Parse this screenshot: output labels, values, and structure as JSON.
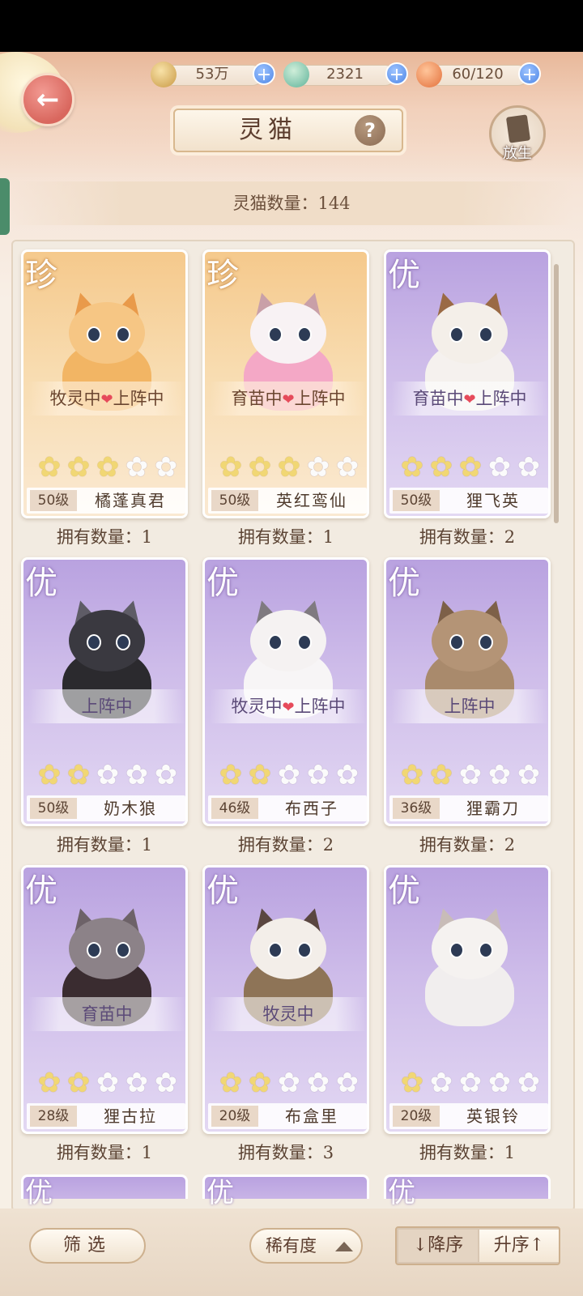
{
  "resources": [
    {
      "name": "paw-coin",
      "value": "53万"
    },
    {
      "name": "jade-gem",
      "value": "2321"
    },
    {
      "name": "food-bowl",
      "value": "60/120"
    }
  ],
  "header": {
    "title": "灵猫",
    "help": "?",
    "release_label": "放生"
  },
  "count_text": "灵猫数量：144",
  "cats": [
    {
      "rarity": "珍",
      "style": "gold",
      "status_left": "牧灵中",
      "status_right": "上阵中",
      "stars": 3,
      "level": "50级",
      "name": "橘蓬真君",
      "owned": "拥有数量：1",
      "fur": "#f2b564",
      "head": "#f6c684",
      "ear": "#e99a4a"
    },
    {
      "rarity": "珍",
      "style": "gold",
      "status_left": "育苗中",
      "status_right": "上阵中",
      "stars": 3,
      "level": "50级",
      "name": "英红鸾仙",
      "owned": "拥有数量：1",
      "fur": "#f4a8c6",
      "head": "#f8f2f4",
      "ear": "#c9a0a8"
    },
    {
      "rarity": "优",
      "style": "purple",
      "status_left": "育苗中",
      "status_right": "上阵中",
      "stars": 3,
      "level": "50级",
      "name": "狸飞英",
      "owned": "拥有数量：2",
      "fur": "#f5f1ee",
      "head": "#f4efe9",
      "ear": "#9a6a45"
    },
    {
      "rarity": "优",
      "style": "purple",
      "status_left": "",
      "status_right": "上阵中",
      "stars": 2,
      "level": "50级",
      "name": "奶木狼",
      "owned": "拥有数量：1",
      "fur": "#2b2a2e",
      "head": "#3a3940",
      "ear": "#5e5c66"
    },
    {
      "rarity": "优",
      "style": "purple",
      "status_left": "牧灵中",
      "status_right": "上阵中",
      "stars": 2,
      "level": "46级",
      "name": "布西子",
      "owned": "拥有数量：2",
      "fur": "#f7f5f6",
      "head": "#f5f2f2",
      "ear": "#7f7a80"
    },
    {
      "rarity": "优",
      "style": "purple",
      "status_left": "",
      "status_right": "上阵中",
      "stars": 2,
      "level": "36级",
      "name": "狸霸刀",
      "owned": "拥有数量：2",
      "fur": "#a98a6c",
      "head": "#b49476",
      "ear": "#7d6048"
    },
    {
      "rarity": "优",
      "style": "purple",
      "status_left": "",
      "status_right": "育苗中",
      "stars": 2,
      "level": "28级",
      "name": "狸古拉",
      "owned": "拥有数量：1",
      "fur": "#3a2c30",
      "head": "#8c8288",
      "ear": "#6d6268"
    },
    {
      "rarity": "优",
      "style": "purple",
      "status_left": "",
      "status_right": "牧灵中",
      "stars": 2,
      "level": "20级",
      "name": "布盒里",
      "owned": "拥有数量：3",
      "fur": "#8e7457",
      "head": "#f3eee9",
      "ear": "#5a4640"
    },
    {
      "rarity": "优",
      "style": "purple",
      "status_left": "",
      "status_right": "",
      "stars": 1,
      "level": "20级",
      "name": "英银铃",
      "owned": "拥有数量：1",
      "fur": "#f1eeee",
      "head": "#f5f2f0",
      "ear": "#c8bcb8"
    }
  ],
  "peek_rarity": [
    "优",
    "优",
    "优"
  ],
  "bottom": {
    "filter": "筛选",
    "rarity": "稀有度",
    "sort_desc": "↓降序",
    "sort_asc": "升序↑"
  }
}
